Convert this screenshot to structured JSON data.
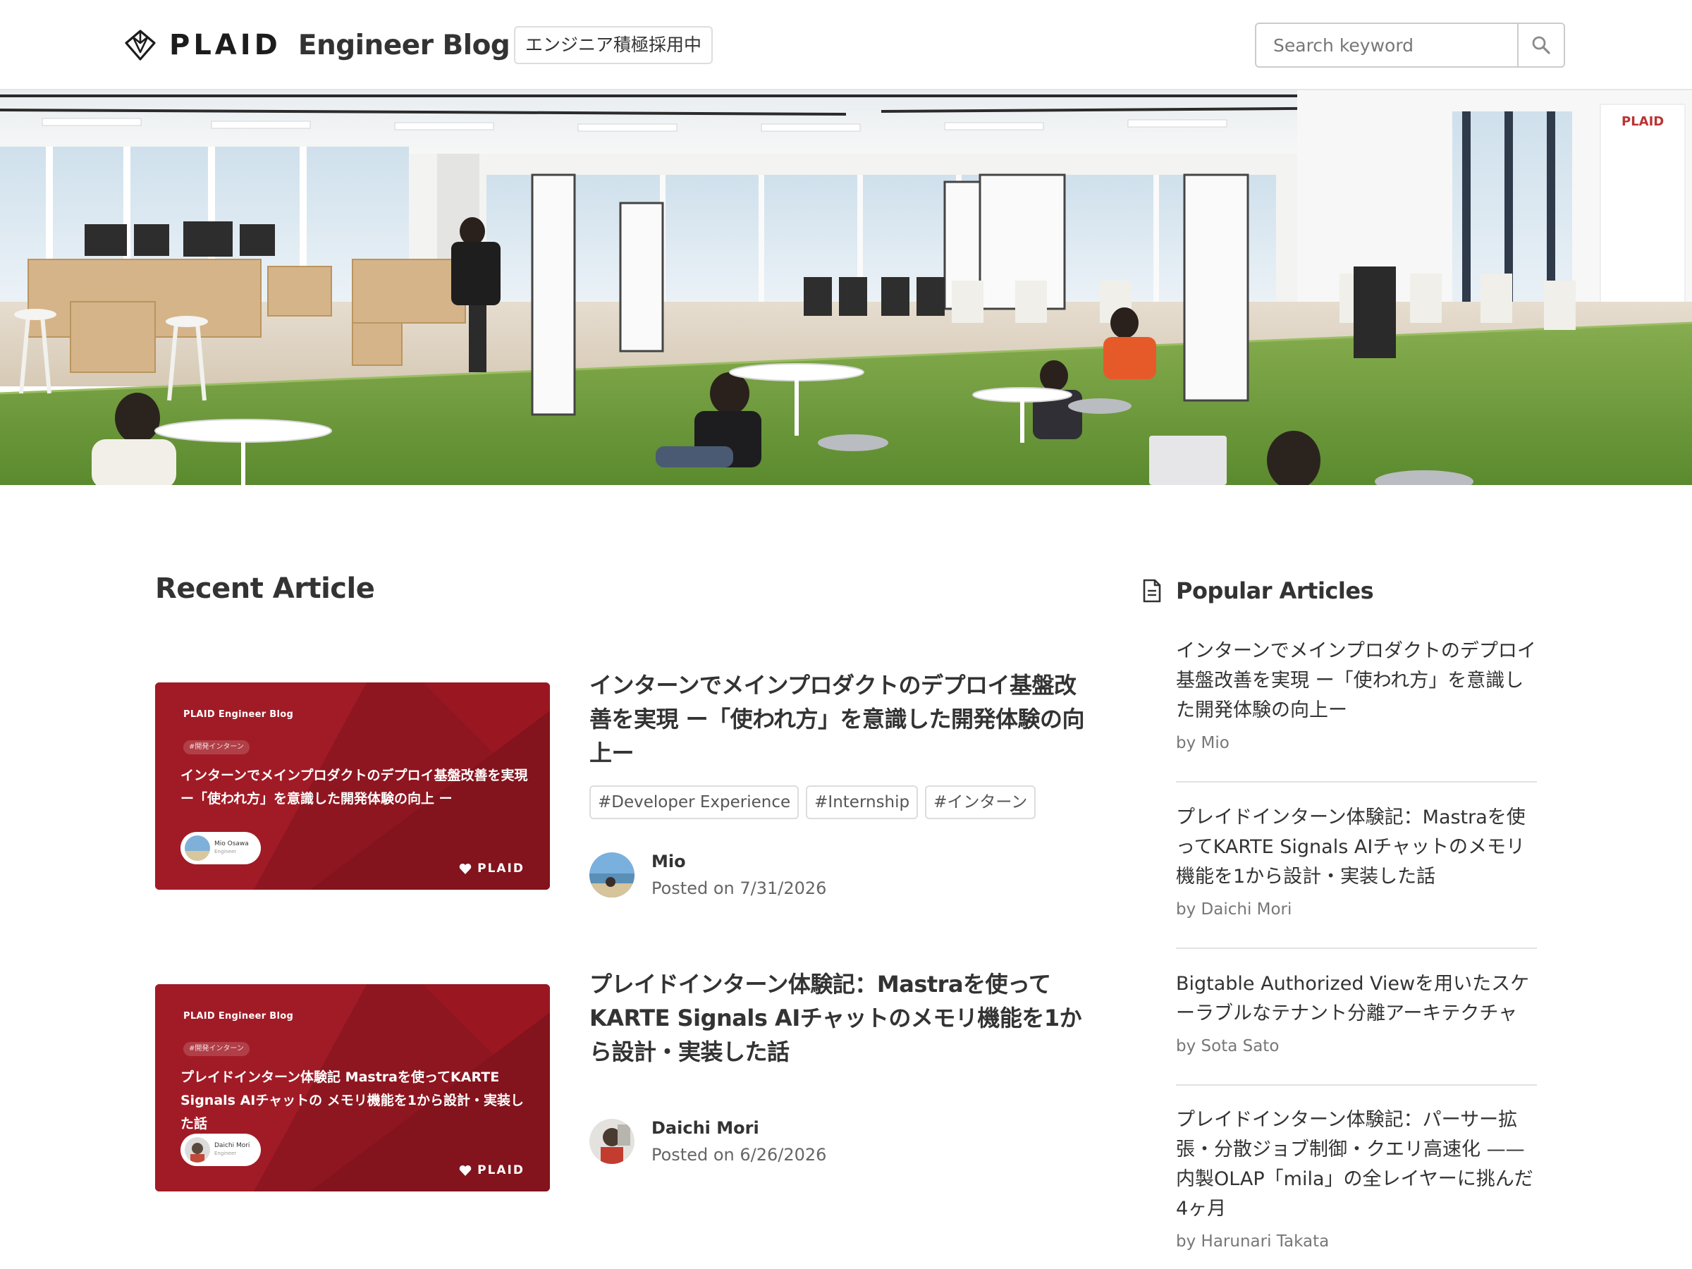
{
  "header": {
    "logo_text": "PLAID",
    "site_name": "Engineer Blog",
    "hiring_badge": "エンジニア積極採用中",
    "search_placeholder": "Search keyword"
  },
  "recent": {
    "title": "Recent Article",
    "articles": [
      {
        "title": "インターンでメインプロダクトのデプロイ基盤改善を実現 ー「使われ方」を意識した開発体験の向上ー",
        "tags": [
          "#Developer Experience",
          "#Internship",
          "#インターン"
        ],
        "author": "Mio",
        "date": "Posted on 7/31/2026",
        "thumb": {
          "brand": "PLAID Engineer Blog",
          "tag": "#開発インターン",
          "title": "インターンでメインプロダクトのデプロイ基盤改善を実現 ー「使われ方」を意識した開発体験の向上 ー",
          "author_name": "Mio Osawa",
          "author_role": "Engineer",
          "logo": "PLAID"
        }
      },
      {
        "title": "プレイドインターン体験記：Mastraを使ってKARTE Signals AIチャットのメモリ機能を1から設計・実装した話",
        "tags": [],
        "author": "Daichi Mori",
        "date": "Posted on 6/26/2026",
        "thumb": {
          "brand": "PLAID Engineer Blog",
          "tag": "#開発インターン",
          "title": "プレイドインターン体験記 Mastraを使ってKARTE Signals AIチャットの メモリ機能を1から設計・実装した話",
          "author_name": "Daichi Mori",
          "author_role": "Engineer",
          "logo": "PLAID"
        }
      }
    ]
  },
  "popular": {
    "title": "Popular Articles",
    "items": [
      {
        "title": "インターンでメインプロダクトのデプロイ基盤改善を実現 ー「使われ方」を意識した開発体験の向上ー",
        "by": "by Mio"
      },
      {
        "title": "プレイドインターン体験記：Mastraを使ってKARTE Signals AIチャットのメモリ機能を1から設計・実装した話",
        "by": "by Daichi Mori"
      },
      {
        "title": "Bigtable Authorized Viewを用いたスケーラブルなテナント分離アーキテクチャ",
        "by": "by Sota Sato"
      },
      {
        "title": "プレイドインターン体験記：パーサー拡張・分散ジョブ制御・クエリ高速化 —— 内製OLAP「mila」の全レイヤーに挑んだ4ヶ月",
        "by": "by Harunari Takata"
      }
    ]
  },
  "hero": {
    "wall_sign": "PLAID"
  },
  "icons": {
    "logo": "plaid-diamond-icon",
    "search": "search-icon",
    "popular": "document-icon",
    "thumb_logo": "heart-icon"
  },
  "colors": {
    "thumb_red": "#8e1620",
    "text": "#333333",
    "muted": "#777777",
    "border": "#dddddd",
    "turf": "#6c9a3a"
  }
}
